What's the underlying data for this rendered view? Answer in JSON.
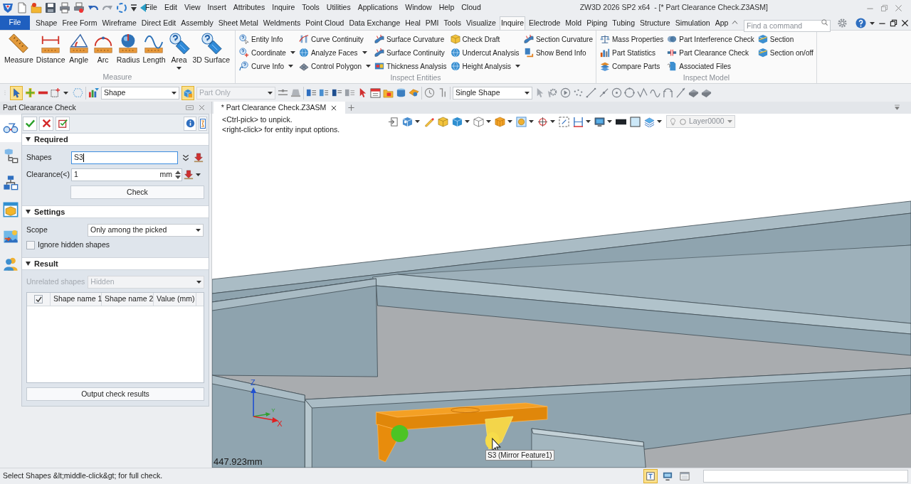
{
  "window": {
    "title": "ZW3D 2026 SP2 x64  - [* Part Clearance Check.Z3ASM]"
  },
  "menu": [
    "File",
    "Edit",
    "View",
    "Insert",
    "Attributes",
    "Inquire",
    "Tools",
    "Utilities",
    "Applications",
    "Window",
    "Help",
    "Cloud"
  ],
  "ribbon_tabs": [
    {
      "label": "File",
      "kind": "backstage",
      "selected": false
    },
    {
      "label": "Shape",
      "kind": "tab",
      "selected": false
    },
    {
      "label": "Free Form",
      "kind": "tab",
      "selected": false
    },
    {
      "label": "Wireframe",
      "kind": "tab",
      "selected": false
    },
    {
      "label": "Direct Edit",
      "kind": "tab",
      "selected": false
    },
    {
      "label": "Assembly",
      "kind": "tab",
      "selected": false
    },
    {
      "label": "Sheet Metal",
      "kind": "tab",
      "selected": false
    },
    {
      "label": "Weldments",
      "kind": "tab",
      "selected": false
    },
    {
      "label": "Point Cloud",
      "kind": "tab",
      "selected": false
    },
    {
      "label": "Data Exchange",
      "kind": "tab",
      "selected": false
    },
    {
      "label": "Heal",
      "kind": "tab",
      "selected": false
    },
    {
      "label": "PMI",
      "kind": "tab",
      "selected": false
    },
    {
      "label": "Tools",
      "kind": "tab",
      "selected": false
    },
    {
      "label": "Visualize",
      "kind": "tab",
      "selected": false
    },
    {
      "label": "Inquire",
      "kind": "tab",
      "selected": true
    },
    {
      "label": "Electrode",
      "kind": "tab",
      "selected": false
    },
    {
      "label": "Mold",
      "kind": "tab",
      "selected": false
    },
    {
      "label": "Piping",
      "kind": "tab",
      "selected": false
    },
    {
      "label": "Tubing",
      "kind": "tab",
      "selected": false
    },
    {
      "label": "Structure",
      "kind": "tab",
      "selected": false
    },
    {
      "label": "Simulation",
      "kind": "tab",
      "selected": false
    },
    {
      "label": "App",
      "kind": "tab",
      "selected": false
    }
  ],
  "command_search": {
    "placeholder": "Find a command"
  },
  "ribbon_groups": [
    {
      "label": "Measure",
      "kind": "large",
      "buttons": [
        {
          "label": "Measure",
          "dropdown": false
        },
        {
          "label": "Distance",
          "dropdown": false
        },
        {
          "label": "Angle",
          "dropdown": false
        },
        {
          "label": "Arc",
          "dropdown": false
        },
        {
          "label": "Radius",
          "dropdown": false
        },
        {
          "label": "Length",
          "dropdown": false
        },
        {
          "label": "Area",
          "dropdown": true
        },
        {
          "label": "3D Surface",
          "dropdown": false
        }
      ]
    },
    {
      "label": "Inspect Entities",
      "kind": "small",
      "columns": [
        [
          {
            "label": "Entity Info",
            "dropdown": false
          },
          {
            "label": "Coordinate",
            "dropdown": true
          },
          {
            "label": "Curve Info",
            "dropdown": true
          }
        ],
        [
          {
            "label": "Curve Continuity",
            "dropdown": false
          },
          {
            "label": "Analyze Faces",
            "dropdown": true
          },
          {
            "label": "Control Polygon",
            "dropdown": true
          }
        ],
        [
          {
            "label": "Surface Curvature",
            "dropdown": false
          },
          {
            "label": "Surface Continuity",
            "dropdown": false
          },
          {
            "label": "Thickness Analysis",
            "dropdown": false
          }
        ],
        [
          {
            "label": "Check Draft",
            "dropdown": false
          },
          {
            "label": "Undercut Analysis",
            "dropdown": false
          },
          {
            "label": "Height Analysis",
            "dropdown": true
          }
        ],
        [
          {
            "label": "Section Curvature",
            "dropdown": false
          },
          {
            "label": "Show Bend Info",
            "dropdown": false
          }
        ]
      ]
    },
    {
      "label": "Inspect Model",
      "kind": "small",
      "columns": [
        [
          {
            "label": "Mass Properties",
            "dropdown": false
          },
          {
            "label": "Part Statistics",
            "dropdown": false
          },
          {
            "label": "Compare Parts",
            "dropdown": false
          }
        ],
        [
          {
            "label": "Part Interference Check",
            "dropdown": false
          },
          {
            "label": "Part Clearance Check",
            "dropdown": false
          },
          {
            "label": "Associated Files",
            "dropdown": false
          }
        ],
        [
          {
            "label": "Section",
            "dropdown": false
          },
          {
            "label": "Section on/off",
            "dropdown": false
          }
        ]
      ]
    }
  ],
  "toolbar": {
    "select_tool_active": true,
    "filter": "Shape",
    "part_filter": {
      "value": "Part Only",
      "active": true,
      "disabled": true
    },
    "pick_mode": "Single Shape"
  },
  "panel": {
    "title": "Part Clearance Check",
    "sections": [
      {
        "kind": "required",
        "label": "Required",
        "expanded": true,
        "shapes": {
          "label": "Shapes",
          "value": "S3",
          "focused": true
        },
        "clearance": {
          "label": "Clearance(<)",
          "value": "1",
          "unit": "mm"
        },
        "check_button": "Check"
      },
      {
        "kind": "settings",
        "label": "Settings",
        "expanded": true,
        "scope": {
          "label": "Scope",
          "value": "Only among the picked"
        },
        "ignore_hidden": {
          "label": "Ignore hidden shapes",
          "checked": false
        }
      },
      {
        "kind": "result",
        "label": "Result",
        "expanded": true,
        "unrelated_shapes": {
          "label": "Unrelated shapes",
          "value": "Hidden",
          "disabled": true
        },
        "table": {
          "select_all": true,
          "columns": [
            "Shape name 1",
            "Shape name 2",
            "Value (mm)"
          ]
        },
        "output_button": "Output check results"
      }
    ]
  },
  "panel_tabs": [
    {
      "selected": true
    },
    {
      "selected": false
    },
    {
      "selected": false
    },
    {
      "selected": false
    },
    {
      "selected": false
    },
    {
      "selected": false
    }
  ],
  "document_tabs": [
    {
      "label": "* Part Clearance Check.Z3ASM",
      "selected": true
    }
  ],
  "viewport": {
    "hints": [
      "<Ctrl-pick> to unpick.",
      "<right-click> for entity input options."
    ],
    "layer": "Layer0000",
    "axis_labels": {
      "z": "Z",
      "y": "Y",
      "x": "X"
    },
    "tooltip": "S3 (Mirror Feature1)",
    "distance": "447.923mm"
  },
  "status_bar": {
    "prompt": "Select Shapes &lt;middle-click&gt; for full check.",
    "tools": [
      {
        "selected": true
      },
      {
        "selected": false
      },
      {
        "selected": false
      }
    ]
  }
}
